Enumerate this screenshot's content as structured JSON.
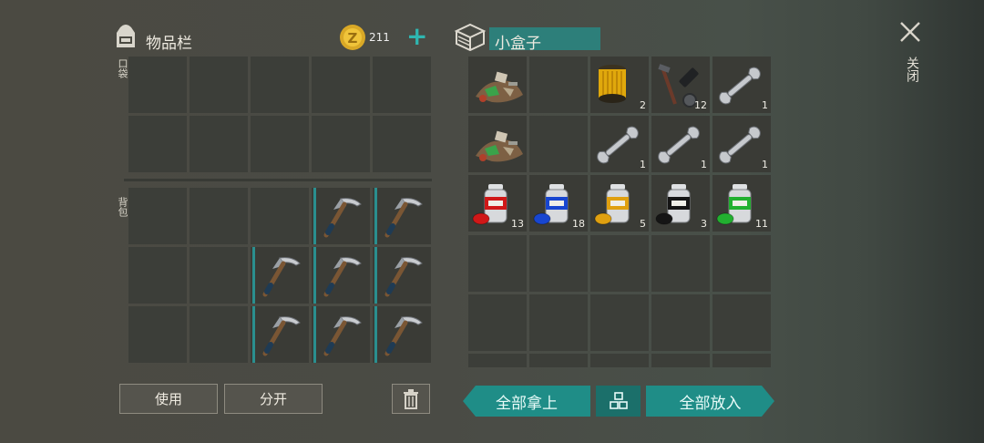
{
  "inventory": {
    "title": "物品栏",
    "coins": "211",
    "pocket_label": "口袋",
    "backpack_label": "背包"
  },
  "container": {
    "title": "小盒子"
  },
  "close_label": "关闭",
  "buttons": {
    "use": "使用",
    "split": "分开",
    "take_all": "全部拿上",
    "put_all": "全部放入"
  },
  "pocket_slots": [
    "",
    "",
    "",
    "",
    "",
    "",
    "",
    "",
    "",
    ""
  ],
  "backpack_slots": [
    {
      "item": null
    },
    {
      "item": null
    },
    {
      "item": null
    },
    {
      "item": "pickaxe-icon"
    },
    {
      "item": "pickaxe-icon"
    },
    {
      "item": null
    },
    {
      "item": null
    },
    {
      "item": "pickaxe-icon"
    },
    {
      "item": "pickaxe-icon"
    },
    {
      "item": "pickaxe-icon"
    },
    {
      "item": null
    },
    {
      "item": null
    },
    {
      "item": "pickaxe-icon"
    },
    {
      "item": "pickaxe-icon"
    },
    {
      "item": "pickaxe-icon"
    }
  ],
  "box_slots": [
    {
      "item": "scrap-pile-icon",
      "count": ""
    },
    {
      "item": null,
      "count": ""
    },
    {
      "item": "oil-filter-icon",
      "count": "2"
    },
    {
      "item": "tool-parts-icon",
      "count": "12"
    },
    {
      "item": "wrench-icon",
      "count": "1"
    },
    {
      "item": "scrap-pile-icon",
      "count": ""
    },
    {
      "item": null,
      "count": ""
    },
    {
      "item": "wrench-icon",
      "count": "1"
    },
    {
      "item": "wrench-icon",
      "count": "1"
    },
    {
      "item": "wrench-icon",
      "count": "1"
    },
    {
      "item": "spray-paint-red-icon",
      "count": "13",
      "color": "#d01818"
    },
    {
      "item": "spray-paint-blue-icon",
      "count": "18",
      "color": "#1846d0"
    },
    {
      "item": "spray-paint-yellow-icon",
      "count": "5",
      "color": "#e0a010"
    },
    {
      "item": "spray-paint-black-icon",
      "count": "3",
      "color": "#151515"
    },
    {
      "item": "spray-paint-green-icon",
      "count": "11",
      "color": "#22b030"
    }
  ]
}
